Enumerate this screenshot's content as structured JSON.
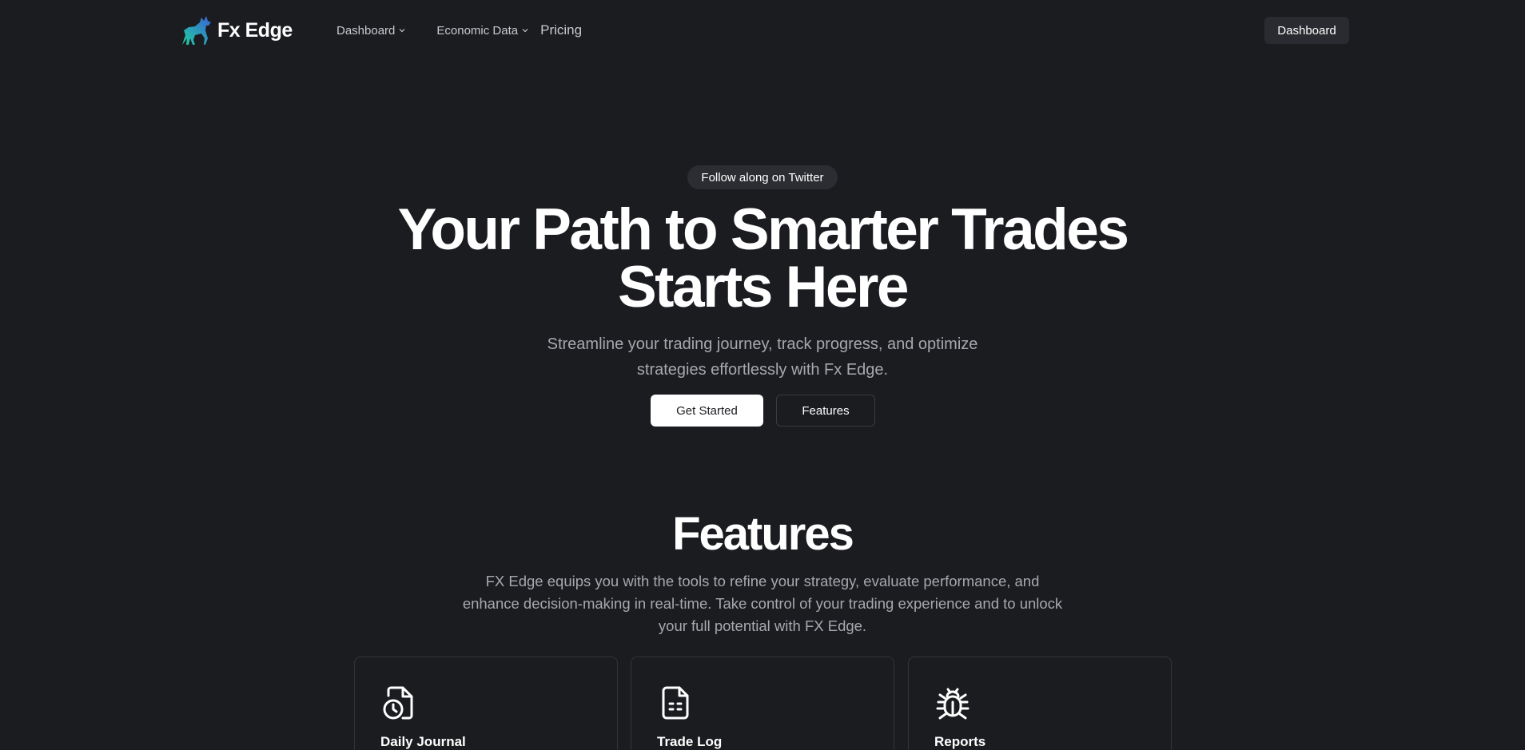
{
  "brand": {
    "name": "Fx Edge",
    "accent": "#1fc4a0",
    "accent_secondary": "#3b6fd6"
  },
  "nav": {
    "items": [
      {
        "label": "Dashboard",
        "has_dropdown": true,
        "icon": "chevron-down-icon"
      },
      {
        "label": "Economic Data",
        "has_dropdown": true,
        "icon": "chevron-down-icon"
      },
      {
        "label": "Pricing",
        "has_dropdown": false
      }
    ],
    "cta_label": "Dashboard"
  },
  "hero": {
    "pill_label": "Follow along on Twitter",
    "title_line1": "Your Path to Smarter Trades",
    "title_line2": "Starts Here",
    "subtitle_line1": "Streamline your trading journey, track progress, and optimize",
    "subtitle_line2": "strategies effortlessly with Fx Edge.",
    "primary_button": "Get Started",
    "secondary_button": "Features"
  },
  "features": {
    "title": "Features",
    "description_line1": "FX Edge equips you with the tools to refine your strategy, evaluate performance, and",
    "description_line2": "enhance decision-making in real-time. Take control of your trading experience and to unlock",
    "description_line3": "your full potential with FX Edge.",
    "cards": [
      {
        "title": "Daily Journal",
        "icon": "file-clock-icon"
      },
      {
        "title": "Trade Log",
        "icon": "file-text-icon"
      },
      {
        "title": "Reports",
        "icon": "bug-icon"
      }
    ]
  },
  "colors": {
    "background": "#1b1c20",
    "muted_text": "#a7a8ae",
    "nav_text": "#c9cad0",
    "card_border": "#33343a"
  }
}
